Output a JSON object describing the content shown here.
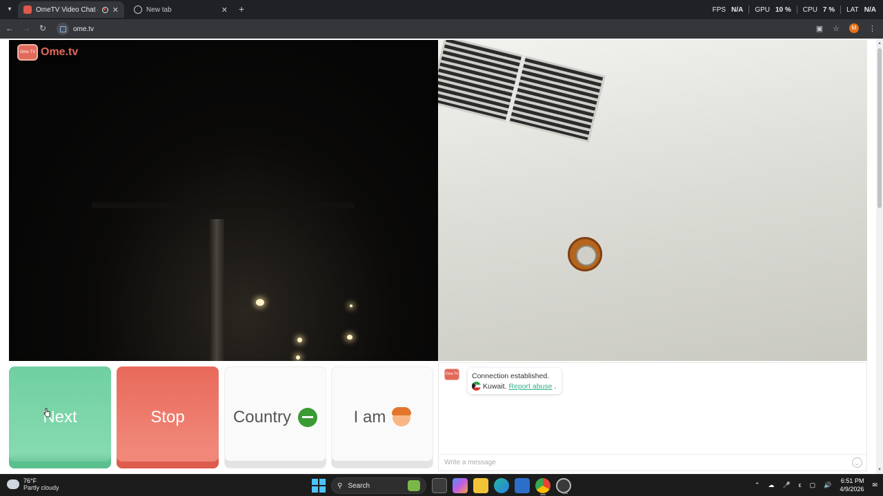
{
  "browser": {
    "tabs": [
      {
        "title": "OmeTV Video Chat — Ome",
        "active": true
      },
      {
        "title": "New tab",
        "active": false
      }
    ],
    "perf": {
      "fps_label": "FPS",
      "fps_value": "N/A",
      "gpu_label": "GPU",
      "gpu_value": "10 %",
      "cpu_label": "CPU",
      "cpu_value": "7 %",
      "lat_label": "LAT",
      "lat_value": "N/A"
    },
    "url": "ome.tv",
    "profile_initial": "M"
  },
  "site": {
    "logo_badge": "Ome TV",
    "logo_text": "Ome.tv"
  },
  "controls": {
    "next": "Next",
    "stop": "Stop",
    "country": "Country",
    "iam": "I am"
  },
  "chat": {
    "logo_badge": "Ome TV",
    "status": "Connection established.",
    "country": "Kuwait.",
    "report": "Report abuse",
    "report_suffix": ".",
    "placeholder": "Write a message"
  },
  "taskbar": {
    "temperature": "76°F",
    "condition": "Partly cloudy",
    "search": "Search",
    "time": "6:51 PM",
    "date": "4/9/2026"
  },
  "colors": {
    "next": "#6fd0a0",
    "stop": "#e8695a",
    "brand": "#e26a5a",
    "link": "#2fb08a"
  }
}
